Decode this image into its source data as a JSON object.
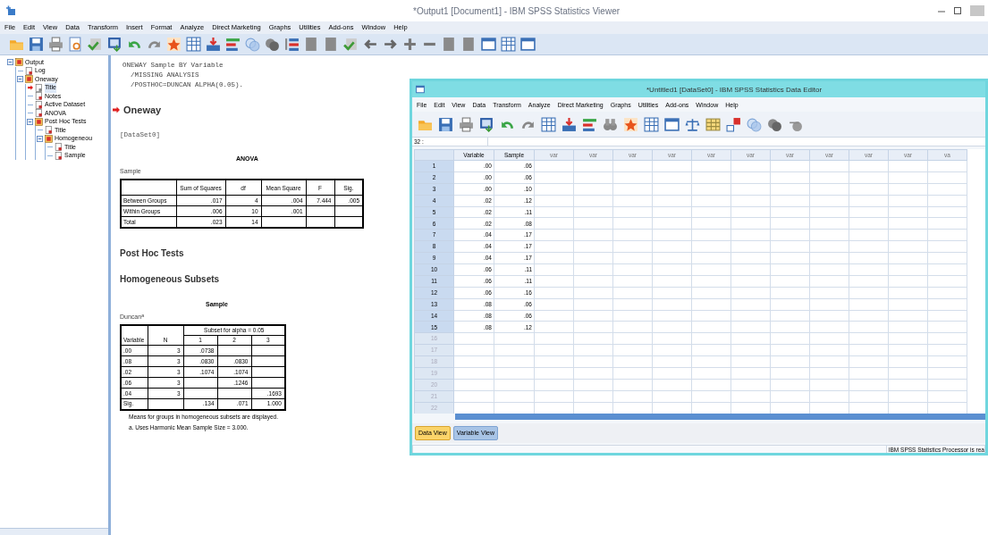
{
  "window": {
    "title": "*Output1 [Document1] - IBM SPSS Statistics Viewer"
  },
  "menu": [
    "File",
    "Edit",
    "View",
    "Data",
    "Transform",
    "Insert",
    "Format",
    "Analyze",
    "Direct Marketing",
    "Graphs",
    "Utilities",
    "Add-ons",
    "Window",
    "Help"
  ],
  "outline": [
    {
      "label": "Output",
      "expanded": true,
      "selected": false,
      "children": [
        {
          "label": "Log",
          "selected": false
        },
        {
          "label": "Oneway",
          "expanded": true,
          "selected": false,
          "children": [
            {
              "label": "Title",
              "selected": true
            },
            {
              "label": "Notes",
              "selected": false
            },
            {
              "label": "Active Dataset",
              "selected": false
            },
            {
              "label": "ANOVA",
              "selected": false
            },
            {
              "label": "Post Hoc Tests",
              "expanded": true,
              "selected": false,
              "children": [
                {
                  "label": "Title",
                  "selected": false
                },
                {
                  "label": "Homogeneou",
                  "expanded": true,
                  "selected": false,
                  "children": [
                    {
                      "label": "Title",
                      "selected": false
                    },
                    {
                      "label": "Sample",
                      "selected": false
                    }
                  ]
                }
              ]
            }
          ]
        }
      ]
    }
  ],
  "output": {
    "syntax": [
      "ONEWAY Sample BY Variable",
      "  /MISSING ANALYSIS",
      "  /POSTHOC=DUNCAN ALPHA(0.05)."
    ],
    "heading": {
      "text": "Oneway",
      "current": true
    },
    "dataset": "[DataSet0]",
    "anova": {
      "title": "ANOVA",
      "subtitle": "Sample",
      "columns": [
        "Sum of Squares",
        "df",
        "Mean Square",
        "F",
        "Sig."
      ],
      "rows": [
        {
          "label": "Between Groups",
          "cells": [
            ".017",
            "4",
            ".004",
            "7.444",
            ".005"
          ]
        },
        {
          "label": "Within Groups",
          "cells": [
            ".006",
            "10",
            ".001",
            null,
            null
          ]
        },
        {
          "label": "Total",
          "cells": [
            ".023",
            "14",
            null,
            null,
            null
          ]
        }
      ]
    },
    "post_hoc_title": "Post Hoc Tests",
    "subsets_title": "Homogeneous Subsets",
    "subsets": {
      "title": "Sample",
      "subtitle": "Duncan$^{a}$",
      "group_header": "Subset for alpha = 0.05",
      "columns": [
        "Variable",
        "N",
        "1",
        "2",
        "3"
      ],
      "rows": [
        {
          "cells": [
            ".00",
            "3",
            ".0738",
            null,
            null
          ]
        },
        {
          "cells": [
            ".08",
            "3",
            ".0830",
            ".0830",
            null
          ]
        },
        {
          "cells": [
            ".02",
            "3",
            ".1074",
            ".1074",
            null
          ]
        },
        {
          "cells": [
            ".06",
            "3",
            null,
            ".1246",
            null
          ]
        },
        {
          "cells": [
            ".04",
            "3",
            null,
            null,
            ".1693"
          ]
        },
        {
          "cells": [
            "Sig.",
            null,
            ".134",
            ".071",
            "1.000"
          ]
        }
      ],
      "notes": [
        "Means for groups in homogeneous subsets are displayed.",
        "a. Uses Harmonic Mean Sample Size = 3.000."
      ]
    }
  },
  "data_editor": {
    "title": "*Untitled1 [DataSet0] - IBM SPSS Statistics Data Editor",
    "menu": [
      "File",
      "Edit",
      "View",
      "Data",
      "Transform",
      "Analyze",
      "Direct Marketing",
      "Graphs",
      "Utilities",
      "Add-ons",
      "Window",
      "Help"
    ],
    "cell_ref": "32 :",
    "columns": [
      "Variable",
      "Sample",
      "var",
      "var",
      "var",
      "var",
      "var",
      "var",
      "var",
      "var",
      "var",
      "var",
      "va"
    ],
    "rows": [
      {
        "number": "1",
        "cells": [
          ".00",
          ".06"
        ]
      },
      {
        "number": "2",
        "cells": [
          ".00",
          ".06"
        ]
      },
      {
        "number": "3",
        "cells": [
          ".00",
          ".10"
        ]
      },
      {
        "number": "4",
        "cells": [
          ".02",
          ".12"
        ]
      },
      {
        "number": "5",
        "cells": [
          ".02",
          ".11"
        ]
      },
      {
        "number": "6",
        "cells": [
          ".02",
          ".08"
        ]
      },
      {
        "number": "7",
        "cells": [
          ".04",
          ".17"
        ]
      },
      {
        "number": "8",
        "cells": [
          ".04",
          ".17"
        ]
      },
      {
        "number": "9",
        "cells": [
          ".04",
          ".17"
        ]
      },
      {
        "number": "10",
        "cells": [
          ".06",
          ".11"
        ]
      },
      {
        "number": "11",
        "cells": [
          ".06",
          ".11"
        ]
      },
      {
        "number": "12",
        "cells": [
          ".06",
          ".16"
        ]
      },
      {
        "number": "13",
        "cells": [
          ".08",
          ".06"
        ]
      },
      {
        "number": "14",
        "cells": [
          ".08",
          ".06"
        ]
      },
      {
        "number": "15",
        "cells": [
          ".08",
          ".12"
        ]
      },
      {
        "number": "16"
      },
      {
        "number": "17"
      },
      {
        "number": "18"
      },
      {
        "number": "19"
      },
      {
        "number": "20"
      },
      {
        "number": "21"
      },
      {
        "number": "22"
      }
    ],
    "tabs": [
      {
        "label": "Data View",
        "selected": true
      },
      {
        "label": "Variable View",
        "selected": false
      }
    ],
    "status": "IBM SPSS Statistics Processor is rea"
  }
}
